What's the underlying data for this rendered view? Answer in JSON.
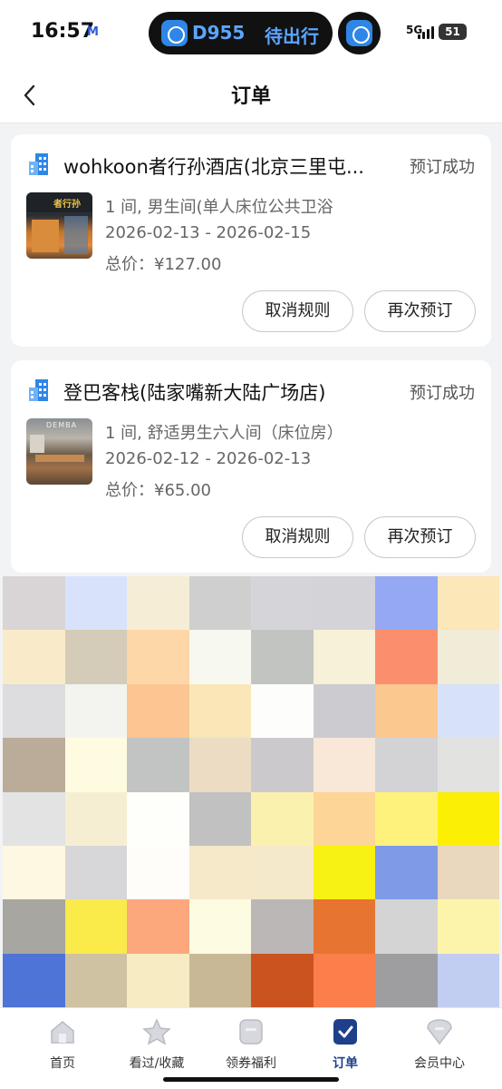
{
  "status_bar": {
    "time": "16:57",
    "carrier_badge": "M",
    "live_activity": {
      "train": "D955",
      "status": "待出行"
    },
    "network": "5G",
    "battery": "51"
  },
  "nav": {
    "title": "订单",
    "back_icon": "chevron-left-icon"
  },
  "orders": [
    {
      "hotel_name": "wohkoon者行孙酒店(北京三里屯...",
      "status": "预订成功",
      "room": "1 间, 男生间(单人床位公共卫浴",
      "dates": "2026-02-13 - 2026-02-15",
      "price": "总价：¥127.00",
      "thumb_sign": "者行孙",
      "cancel_label": "取消规则",
      "rebook_label": "再次预订"
    },
    {
      "hotel_name": "登巴客栈(陆家嘴新大陆广场店)",
      "status": "预订成功",
      "room": "1 间, 舒适男生六人间（床位房）",
      "dates": "2026-02-12 - 2026-02-13",
      "price": "总价：¥65.00",
      "thumb_sign": "DEMBA",
      "cancel_label": "取消规则",
      "rebook_label": "再次预订"
    }
  ],
  "mosaic_colors": [
    "#d9d4d6",
    "#d8e3fb",
    "#f5edd5",
    "#cfcfcf",
    "#d5d4d8",
    "#d4d3d8",
    "#94a8f4",
    "#fbe7b7",
    "#f9ebc9",
    "#d4ccb8",
    "#fdd7a8",
    "#f7f8f0",
    "#c2c4c1",
    "#f6f1d8",
    "#fb8f6d",
    "#f1ecd8",
    "#dddcdf",
    "#f3f4ef",
    "#fdc591",
    "#f9e7b7",
    "#fdfefb",
    "#cccbd0",
    "#fbc890",
    "#d7e1f7",
    "#bbac9a",
    "#fefbe1",
    "#c2c4c3",
    "#ecdcc3",
    "#ccc9cc",
    "#f9e8d8",
    "#d3d3d6",
    "#e2e3e0",
    "#e3e3e3",
    "#f5eed3",
    "#fefefa",
    "#c1c1c1",
    "#fbf1ae",
    "#fdd596",
    "#fef27c",
    "#fcef06",
    "#fef7e1",
    "#d7d6d8",
    "#fefdfa",
    "#f5e9ca",
    "#f5e9cc",
    "#f8f212",
    "#7f9ae6",
    "#e9d8be",
    "#a8a6a0",
    "#faea4a",
    "#fda77d",
    "#fdfbe1",
    "#bbb7b6",
    "#e77431",
    "#d3d4d3",
    "#fdf4ac",
    "#4f74d7",
    "#cfc2a3",
    "#f7ebc3",
    "#c9b896",
    "#cb531f",
    "#fc7e4a",
    "#9e9ea1",
    "#c1cdf1"
  ],
  "tabs": [
    {
      "label": "首页",
      "icon": "home-icon"
    },
    {
      "label": "看过/收藏",
      "icon": "star-icon"
    },
    {
      "label": "领券福利",
      "icon": "coupon-icon"
    },
    {
      "label": "订单",
      "icon": "orders-check-icon",
      "active": true
    },
    {
      "label": "会员中心",
      "icon": "member-icon"
    }
  ],
  "colors": {
    "accent": "#1e3f8a",
    "hotel_icon": "#2f86e6",
    "live_activity_text": "#5ba5ff"
  }
}
